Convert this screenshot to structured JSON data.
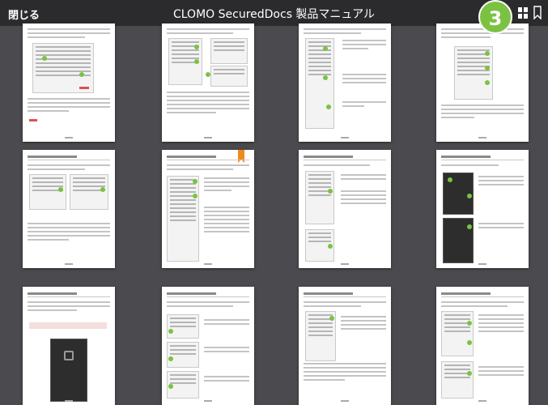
{
  "toolbar": {
    "close_label": "閉じる",
    "title": "CLOMO SecuredDocs 製品マニュアル",
    "step_number": "3"
  },
  "icons": [
    "grid-view-icon",
    "bookmark-icon"
  ],
  "colors": {
    "toolbar_bg": "#2b2b2e",
    "canvas_bg": "#4b4b4f",
    "accent_green": "#7cc242",
    "bookmark_orange": "#f08a1c"
  },
  "thumbnails": [
    {
      "row": 1,
      "col": 1
    },
    {
      "row": 1,
      "col": 2
    },
    {
      "row": 1,
      "col": 3
    },
    {
      "row": 1,
      "col": 4
    },
    {
      "row": 2,
      "col": 1
    },
    {
      "row": 2,
      "col": 2,
      "bookmarked": true
    },
    {
      "row": 2,
      "col": 3
    },
    {
      "row": 2,
      "col": 4
    },
    {
      "row": 3,
      "col": 1
    },
    {
      "row": 3,
      "col": 2
    },
    {
      "row": 3,
      "col": 3
    },
    {
      "row": 3,
      "col": 4
    }
  ]
}
